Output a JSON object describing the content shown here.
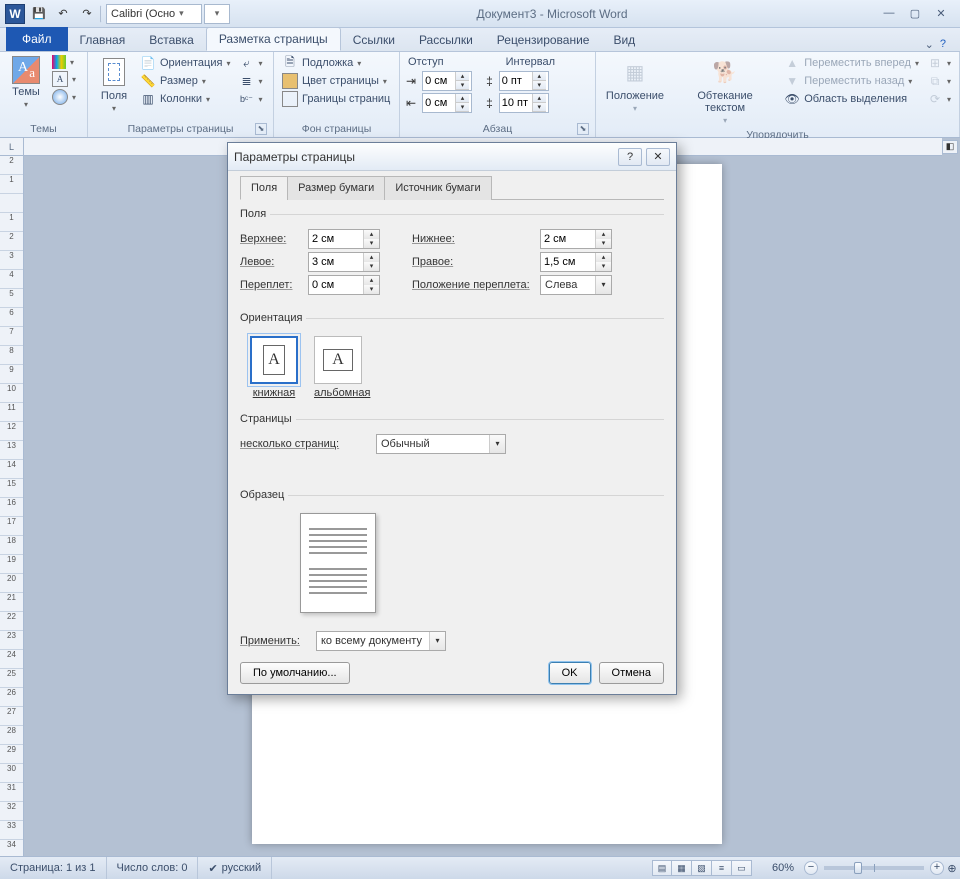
{
  "title": "Документ3 - Microsoft Word",
  "qat": {
    "font": "Calibri (Осно"
  },
  "tabs": {
    "file": "Файл",
    "items": [
      "Главная",
      "Вставка",
      "Разметка страницы",
      "Ссылки",
      "Рассылки",
      "Рецензирование",
      "Вид"
    ],
    "active_index": 2
  },
  "ribbon": {
    "themes": {
      "big": "Темы",
      "label": "Темы"
    },
    "page_setup": {
      "fields": "Поля",
      "orientation": "Ориентация",
      "size": "Размер",
      "columns": "Колонки",
      "label": "Параметры страницы"
    },
    "page_bg": {
      "watermark": "Подложка",
      "color": "Цвет страницы",
      "borders": "Границы страниц",
      "label": "Фон страницы"
    },
    "paragraph": {
      "indent": "Отступ",
      "spacing": "Интервал",
      "left": "0 см",
      "right": "0 см",
      "before": "0 пт",
      "after": "10 пт",
      "label": "Абзац"
    },
    "arrange": {
      "position": "Положение",
      "wrap": "Обтекание текстом",
      "forward": "Переместить вперед",
      "backward": "Переместить назад",
      "selection": "Область выделения",
      "label": "Упорядочить"
    }
  },
  "dialog": {
    "title": "Параметры страницы",
    "tabs": [
      "Поля",
      "Размер бумаги",
      "Источник бумаги"
    ],
    "fields_group": "Поля",
    "top": "Верхнее:",
    "top_v": "2 см",
    "bottom": "Нижнее:",
    "bottom_v": "2 см",
    "left": "Левое:",
    "left_v": "3 см",
    "right": "Правое:",
    "right_v": "1,5 см",
    "gutter": "Переплет:",
    "gutter_v": "0 см",
    "gutterpos": "Положение переплета:",
    "gutterpos_v": "Слева",
    "orient_group": "Ориентация",
    "portrait": "книжная",
    "landscape": "альбомная",
    "pages_group": "Страницы",
    "multi": "несколько страниц:",
    "multi_v": "Обычный",
    "preview_group": "Образец",
    "apply": "Применить:",
    "apply_v": "ко всему документу",
    "default": "По умолчанию...",
    "ok": "OK",
    "cancel": "Отмена"
  },
  "status": {
    "page": "Страница: 1 из 1",
    "words": "Число слов: 0",
    "lang": "русский",
    "zoom": "60%"
  }
}
